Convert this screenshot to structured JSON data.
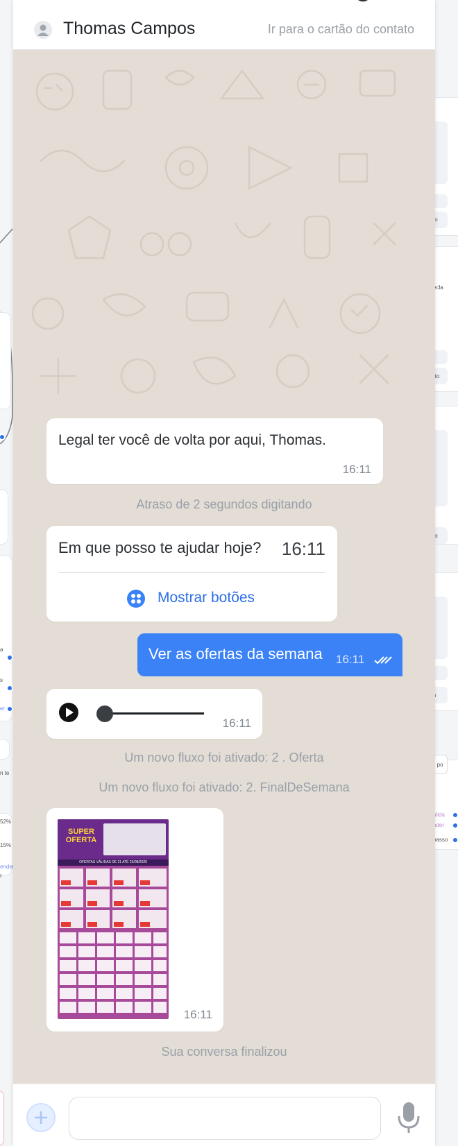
{
  "header": {
    "contact_name": "Thomas Campos",
    "contact_link": "Ir para o cartão do contato"
  },
  "messages": [
    {
      "text": "Legal ter você de volta por aqui, Thomas.",
      "time": "16:11"
    },
    {
      "text": "Em que posso te ajudar hoje?",
      "time": "16:11",
      "button_label": "Mostrar botões"
    },
    {
      "text": "Ver as ofertas da semana",
      "time": "16:11"
    },
    {
      "time": "16:11"
    },
    {
      "time": "16:11"
    }
  ],
  "system": {
    "delay": "Atraso de 2 segundos digitando",
    "flow1": "Um novo fluxo foi ativado: 2 . Oferta",
    "flow2": "Um novo fluxo foi ativado: 2. FinalDeSemana",
    "ended": "Sua conversa finalizou"
  },
  "flyer": {
    "brand_text": "SUPER OFERTA",
    "banner_text": "OFERTAS VÁLIDAS DE 21 ATÉ 23/08/2020"
  },
  "input": {
    "placeholder": ""
  },
  "background_canvas": {
    "labels": [
      "to",
      "ecla",
      "rto",
      "to",
      "o",
      "e po",
      "álida",
      "nder",
      "passo",
      "a",
      "s",
      "er",
      "n te",
      "52%",
      "15%",
      "ender",
      "r"
    ]
  },
  "colors": {
    "accent": "#2f6fe8",
    "outgoing_bubble": "#3b82f6",
    "chat_background": "#e3ddd6"
  }
}
